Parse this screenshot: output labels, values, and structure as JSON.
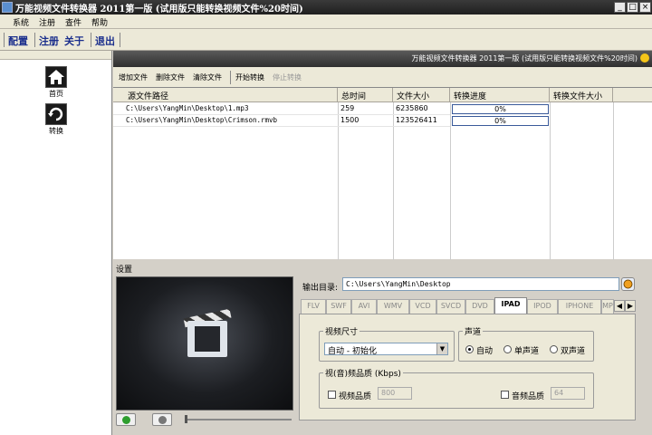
{
  "window": {
    "title": "万能视频文件转换器 2011第一版 (试用版只能转换视频文件%20时间)",
    "controls": [
      "_",
      "□",
      "×"
    ]
  },
  "menu": [
    "系统",
    "注册",
    "查件",
    "帮助"
  ],
  "toolbar": {
    "config": "配置",
    "register": "注册",
    "about": "关于",
    "exit": "退出"
  },
  "nav": [
    {
      "label": "首页",
      "icon": "home-icon"
    },
    {
      "label": "转换",
      "icon": "refresh-icon"
    }
  ],
  "banner": {
    "text": "万能视频文件转换器 2011第一版 (试用版只能转换视频文件%20时间)"
  },
  "filebar": {
    "add": "增加文件",
    "delete": "删除文件",
    "clear": "清除文件",
    "start": "开始转换",
    "stop": "停止转换"
  },
  "table": {
    "headers": [
      "源文件路径",
      "总时间",
      "文件大小",
      "转换进度",
      "转换文件大小"
    ],
    "rows": [
      {
        "path": "C:\\Users\\YangMin\\Desktop\\1.mp3",
        "time": "259",
        "size": "6235860",
        "progress": "0%",
        "out_size": ""
      },
      {
        "path": "C:\\Users\\YangMin\\Desktop\\Crimson.rmvb",
        "time": "1500",
        "size": "123526411",
        "progress": "0%",
        "out_size": ""
      }
    ]
  },
  "settings": {
    "label": "设置",
    "output_label": "输出目录:",
    "output_dir": "C:\\Users\\YangMin\\Desktop",
    "tabs": [
      "FLV",
      "SWF",
      "AVI",
      "WMV",
      "VCD",
      "SVCD",
      "DVD",
      "IPAD",
      "IPOD",
      "IPHONE",
      "MP"
    ],
    "active_tab": "IPAD",
    "video_size": {
      "legend": "视频尺寸",
      "value": "自动 - 初始化"
    },
    "audio_channel": {
      "legend": "声道",
      "options": [
        "自动",
        "单声道",
        "双声道"
      ],
      "selected": "自动"
    },
    "quality": {
      "legend": "视(音)频品质 (Kbps)",
      "video_label": "视频品质",
      "video_value": "800",
      "audio_label": "音频品质",
      "audio_value": "64"
    }
  }
}
